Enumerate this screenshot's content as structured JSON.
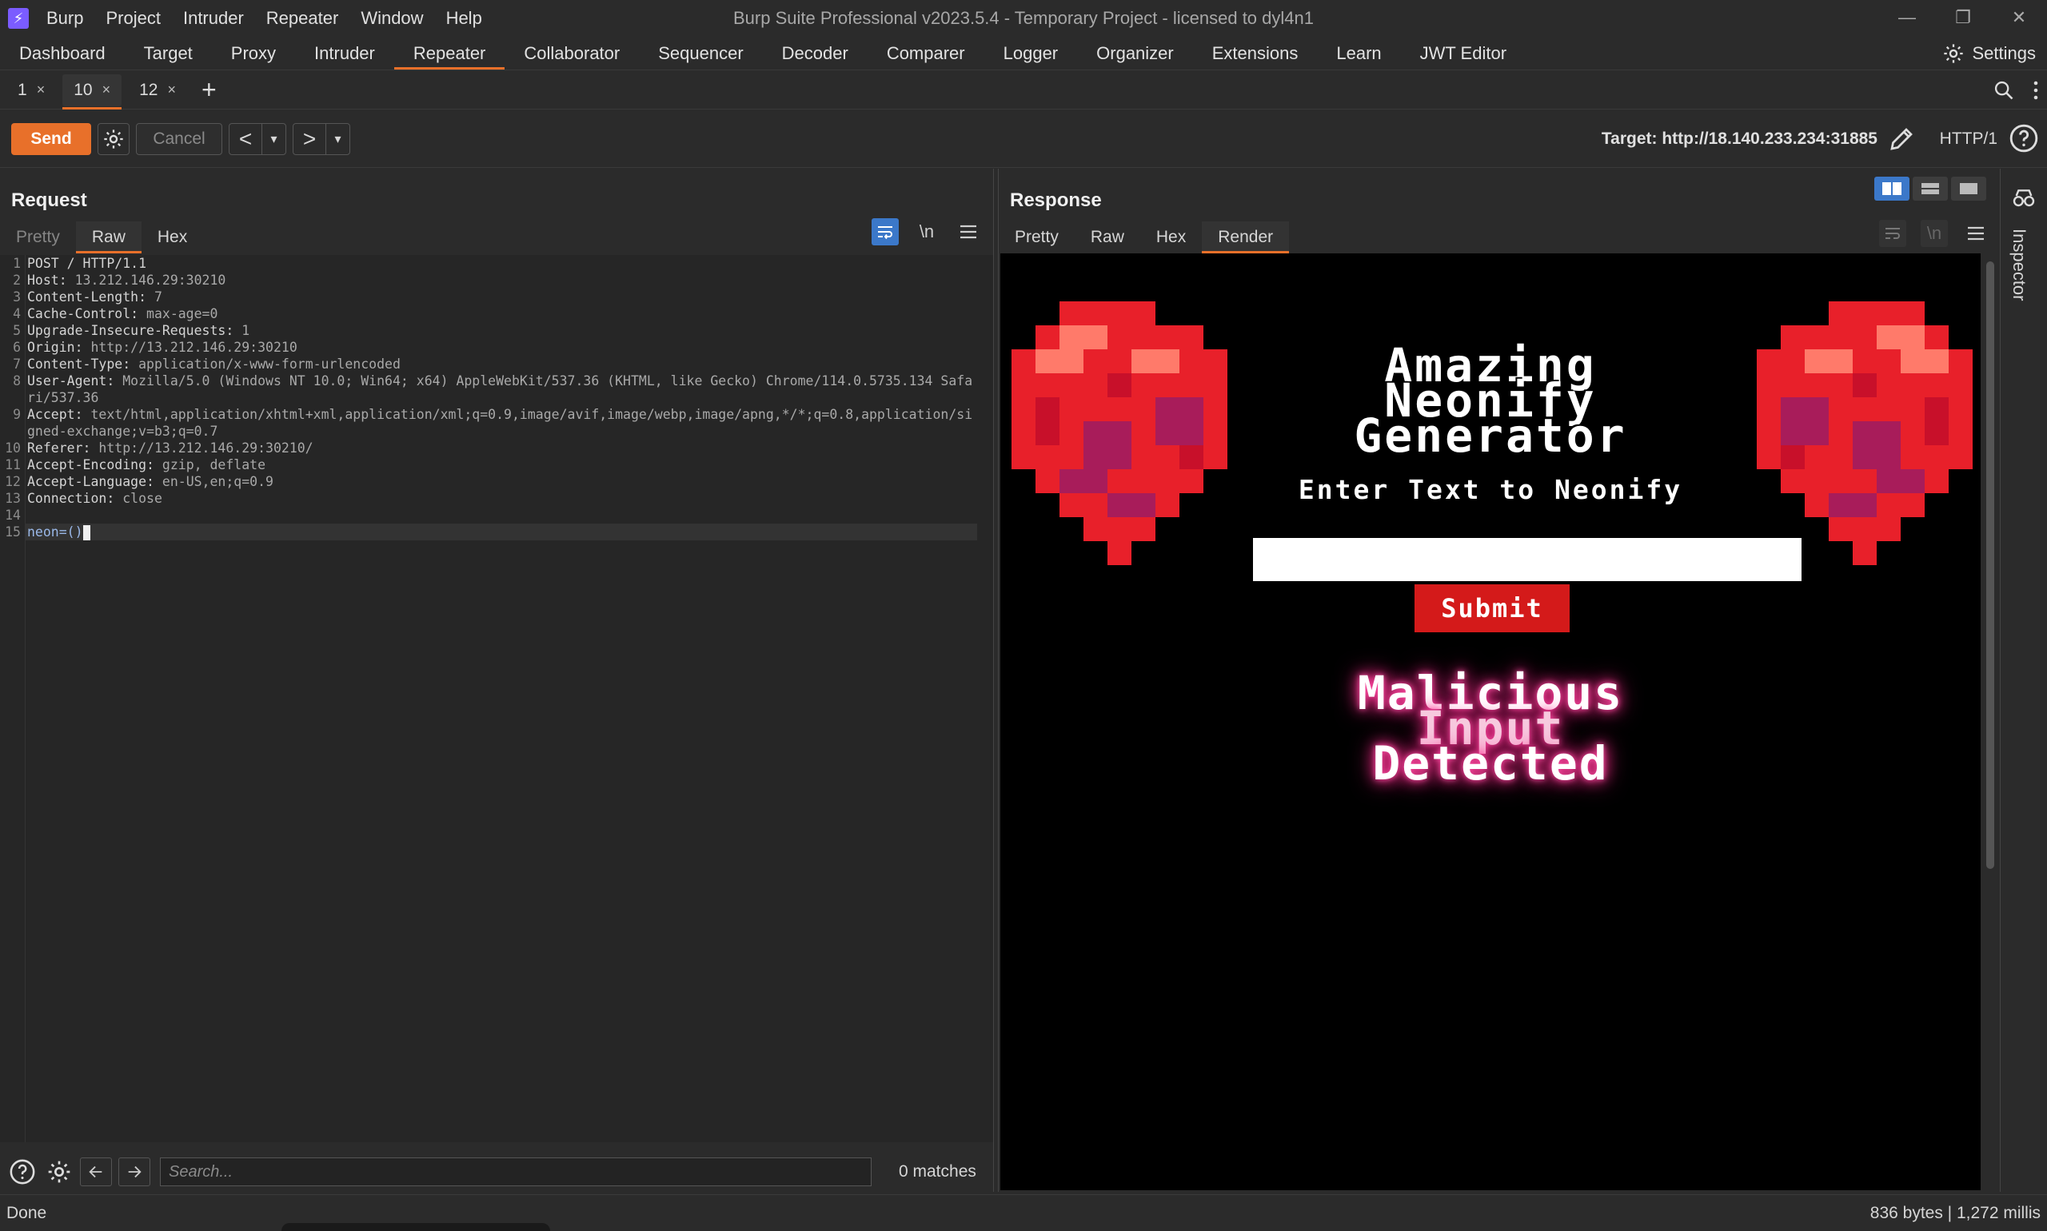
{
  "app": {
    "title": "Burp Suite Professional v2023.5.4 - Temporary Project - licensed to dyl4n1",
    "logo_glyph": "⚡",
    "menu": [
      "Burp",
      "Project",
      "Intruder",
      "Repeater",
      "Window",
      "Help"
    ],
    "window_controls": [
      "—",
      "❐",
      "✕"
    ]
  },
  "main_tabs": [
    "Dashboard",
    "Target",
    "Proxy",
    "Intruder",
    "Repeater",
    "Collaborator",
    "Sequencer",
    "Decoder",
    "Comparer",
    "Logger",
    "Organizer",
    "Extensions",
    "Learn",
    "JWT Editor"
  ],
  "active_main_tab": "Repeater",
  "settings_label": "Settings",
  "repeater_tabs": [
    {
      "label": "1",
      "close": "×"
    },
    {
      "label": "10",
      "close": "×"
    },
    {
      "label": "12",
      "close": "×"
    }
  ],
  "add_tab": "+",
  "toolbar": {
    "send": "Send",
    "cancel": "Cancel",
    "prev": "<",
    "next": ">",
    "dropdown": "▾",
    "target": "Target: http://18.140.233.234:31885",
    "http_version": "HTTP/1"
  },
  "request": {
    "title": "Request",
    "view_tabs": [
      "Pretty",
      "Raw",
      "Hex"
    ],
    "active_view": "Raw",
    "tool_newline": "\\n",
    "lines": [
      {
        "n": "1",
        "key": "POST / HTTP/1.1",
        "val": ""
      },
      {
        "n": "2",
        "key": "Host: ",
        "val": "13.212.146.29:30210"
      },
      {
        "n": "3",
        "key": "Content-Length: ",
        "val": "7"
      },
      {
        "n": "4",
        "key": "Cache-Control: ",
        "val": "max-age=0"
      },
      {
        "n": "5",
        "key": "Upgrade-Insecure-Requests: ",
        "val": "1"
      },
      {
        "n": "6",
        "key": "Origin: ",
        "val": "http://13.212.146.29:30210"
      },
      {
        "n": "7",
        "key": "Content-Type: ",
        "val": "application/x-www-form-urlencoded"
      },
      {
        "n": "8",
        "key": "User-Agent: ",
        "val": "Mozilla/5.0 (Windows NT 10.0; Win64; x64) AppleWebKit/537.36 (KHTML, like Gecko) Chrome/114.0.5735.134 Safari/537.36"
      },
      {
        "n": "9",
        "key": "Accept: ",
        "val": "text/html,application/xhtml+xml,application/xml;q=0.9,image/avif,image/webp,image/apng,*/*;q=0.8,application/signed-exchange;v=b3;q=0.7"
      },
      {
        "n": "10",
        "key": "Referer: ",
        "val": "http://13.212.146.29:30210/"
      },
      {
        "n": "11",
        "key": "Accept-Encoding: ",
        "val": "gzip, deflate"
      },
      {
        "n": "12",
        "key": "Accept-Language: ",
        "val": "en-US,en;q=0.9"
      },
      {
        "n": "13",
        "key": "Connection: ",
        "val": "close"
      },
      {
        "n": "14",
        "key": "",
        "val": ""
      },
      {
        "n": "15",
        "key": "",
        "val": "",
        "param": "neon=()"
      }
    ]
  },
  "search": {
    "placeholder": "Search...",
    "matches": "0 matches"
  },
  "response": {
    "title": "Response",
    "view_tabs": [
      "Pretty",
      "Raw",
      "Hex",
      "Render"
    ],
    "active_view": "Render",
    "tool_newline": "\\n",
    "render": {
      "title_lines": [
        "Amazing",
        "Neonify",
        "Generator"
      ],
      "subtitle": "Enter Text to Neonify",
      "submit": "Submit",
      "result_lines": [
        "Malicious",
        "Input",
        "Detected"
      ]
    }
  },
  "inspector_label": "Inspector",
  "status": {
    "left": "Done",
    "right": "836 bytes | 1,272 millis"
  },
  "colors": {
    "accent": "#e8702a",
    "toggle_active": "#3b78c9",
    "heart_red": "#e8202a",
    "neon_pink": "#ff2d8e"
  }
}
